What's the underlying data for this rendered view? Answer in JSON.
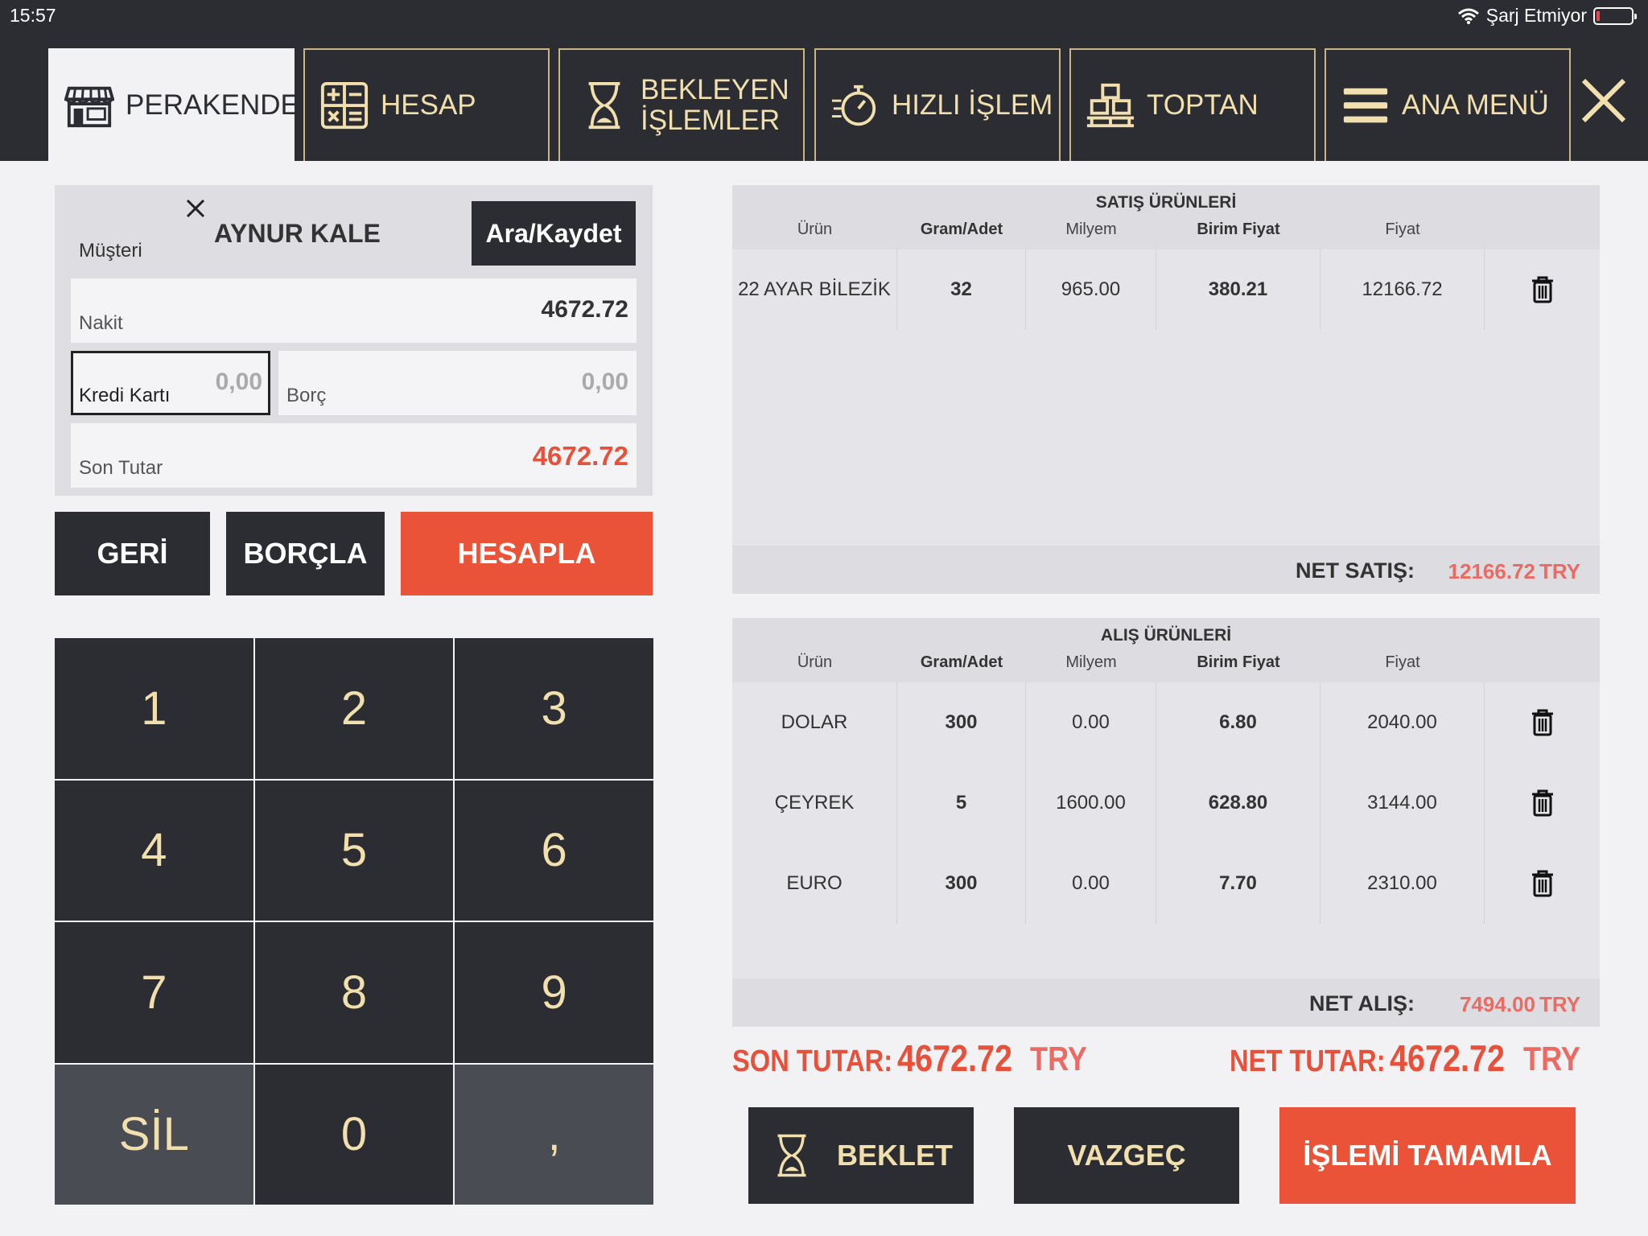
{
  "status": {
    "time": "15:57",
    "charging": "Şarj Etmiyor"
  },
  "tabs": [
    {
      "label": "PERAKENDE",
      "icon": "store-icon"
    },
    {
      "label": "HESAP",
      "icon": "calculator-icon"
    },
    {
      "label": "BEKLEYEN\nİŞLEMLER",
      "icon": "hourglass-icon"
    },
    {
      "label": "HIZLI İŞLEM",
      "icon": "stopwatch-icon"
    },
    {
      "label": "TOPTAN",
      "icon": "boxes-icon"
    },
    {
      "label": "ANA MENÜ",
      "icon": "hamburger-icon"
    }
  ],
  "customer": {
    "label": "Müşteri",
    "name": "AYNUR KALE",
    "search_button": "Ara/Kaydet"
  },
  "payment": {
    "cash_label": "Nakit",
    "cash_value": "4672.72",
    "card_label": "Kredi Kartı",
    "card_value": "0,00",
    "debt_label": "Borç",
    "debt_value": "0,00",
    "total_label": "Son Tutar",
    "total_value": "4672.72"
  },
  "actions": {
    "back": "GERİ",
    "debit": "BORÇLA",
    "calculate": "HESAPLA"
  },
  "keypad": [
    "1",
    "2",
    "3",
    "4",
    "5",
    "6",
    "7",
    "8",
    "9",
    "SİL",
    "0",
    ","
  ],
  "sales": {
    "title": "SATIŞ ÜRÜNLERİ",
    "headers": [
      "Ürün",
      "Gram/Adet",
      "Milyem",
      "Birim Fiyat",
      "Fiyat"
    ],
    "rows": [
      [
        "22 AYAR BİLEZİK",
        "32",
        "965.00",
        "380.21",
        "12166.72"
      ]
    ],
    "footer_label": "NET SATIŞ:",
    "footer_value": "12166.72",
    "footer_currency": "TRY"
  },
  "purchases": {
    "title": "ALIŞ ÜRÜNLERİ",
    "headers": [
      "Ürün",
      "Gram/Adet",
      "Milyem",
      "Birim Fiyat",
      "Fiyat"
    ],
    "rows": [
      [
        "DOLAR",
        "300",
        "0.00",
        "6.80",
        "2040.00"
      ],
      [
        "ÇEYREK",
        "5",
        "1600.00",
        "628.80",
        "3144.00"
      ],
      [
        "EURO",
        "300",
        "0.00",
        "7.70",
        "2310.00"
      ]
    ],
    "footer_label": "NET ALIŞ:",
    "footer_value": "7494.00",
    "footer_currency": "TRY"
  },
  "summary": {
    "son_label": "SON TUTAR:",
    "son_value": "4672.72",
    "son_currency": "TRY",
    "net_label": "NET TUTAR:",
    "net_value": "4672.72",
    "net_currency": "TRY"
  },
  "bottom": {
    "hold": "BEKLET",
    "cancel": "VAZGEÇ",
    "complete": "İŞLEMİ TAMAMLA"
  },
  "colors": {
    "dark": "#2b2d33",
    "gold": "#f1dfae",
    "accent": "#ea5338",
    "background": "#f2f2f5"
  }
}
